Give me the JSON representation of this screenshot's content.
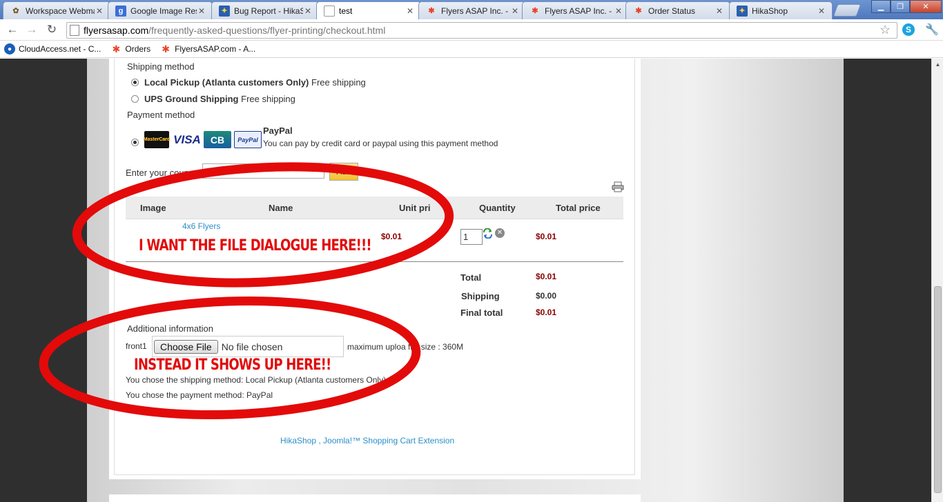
{
  "browser": {
    "tabs": [
      {
        "title": "Workspace Webma",
        "icon": "workspace-icon",
        "color": "#7a5a2a"
      },
      {
        "title": "Google Image Resu",
        "icon": "google-icon",
        "color": "#3b6fd8"
      },
      {
        "title": "Bug Report - HikaS",
        "icon": "hikashop-icon",
        "color": "#2a5fb0"
      },
      {
        "title": "test",
        "icon": "page-icon",
        "color": "#888888"
      },
      {
        "title": "Flyers ASAP Inc. - /",
        "icon": "joomla-icon",
        "color": "#e8442a"
      },
      {
        "title": "Flyers ASAP Inc. - /",
        "icon": "joomla-icon",
        "color": "#e8442a"
      },
      {
        "title": "Order Status",
        "icon": "joomla-icon",
        "color": "#e8442a"
      },
      {
        "title": "HikaShop",
        "icon": "hikashop-icon",
        "color": "#2a5fb0"
      }
    ],
    "url_host": "flyersasap.com",
    "url_path": "/frequently-asked-questions/flyer-printing/checkout.html",
    "bookmarks": [
      {
        "label": "CloudAccess.net - C...",
        "icon": "cloud-icon"
      },
      {
        "label": "Orders",
        "icon": "joomla-icon"
      },
      {
        "label": "FlyersASAP.com - A...",
        "icon": "joomla-icon"
      }
    ]
  },
  "checkout": {
    "shipping_heading": "Shipping method",
    "shipping_options": [
      {
        "name": "Local Pickup (Atlanta customers Only)",
        "note": "Free shipping",
        "checked": true
      },
      {
        "name": "UPS Ground Shipping",
        "note": "Free shipping",
        "checked": false
      }
    ],
    "payment_heading": "Payment method",
    "payment_option": {
      "name": "PayPal",
      "description": "You can pay by credit card or paypal using this payment method",
      "logos": [
        "MasterCard",
        "VISA",
        "CB",
        "PayPal"
      ]
    },
    "coupon_label": "Enter your coupo",
    "coupon_button": "Add",
    "cart_headers": [
      "Image",
      "Name",
      "Unit pri",
      "Quantity",
      "Total price"
    ],
    "cart_item": {
      "name": "4x6 Flyers",
      "unit_price": "$0.01",
      "quantity": "1",
      "total_price": "$0.01"
    },
    "totals": [
      {
        "label": "Total",
        "value": "$0.01"
      },
      {
        "label": "Shipping",
        "value": "$0.00"
      },
      {
        "label": "Final total",
        "value": "$0.01"
      }
    ],
    "additional_heading": "Additional information",
    "file_field_label": "front1",
    "file_button": "Choose File",
    "file_status": "No file chosen",
    "file_size_note": "maximum uploa  file size : 360M",
    "shipping_chosen": "You chose the shipping method: Local Pickup (Atlanta customers Only)",
    "payment_chosen": "You chose the payment method: PayPal",
    "footer_link_hikashop": "HikaShop",
    "footer_sep": " , ",
    "footer_link_joomla": "Joomla!™ Shopping Cart Extension"
  },
  "annotations": {
    "top": "I WANT THE FILE DIALOGUE HERE!!!",
    "bottom": "INSTEAD IT SHOWS UP HERE!!",
    "color": "#e30a0a"
  }
}
